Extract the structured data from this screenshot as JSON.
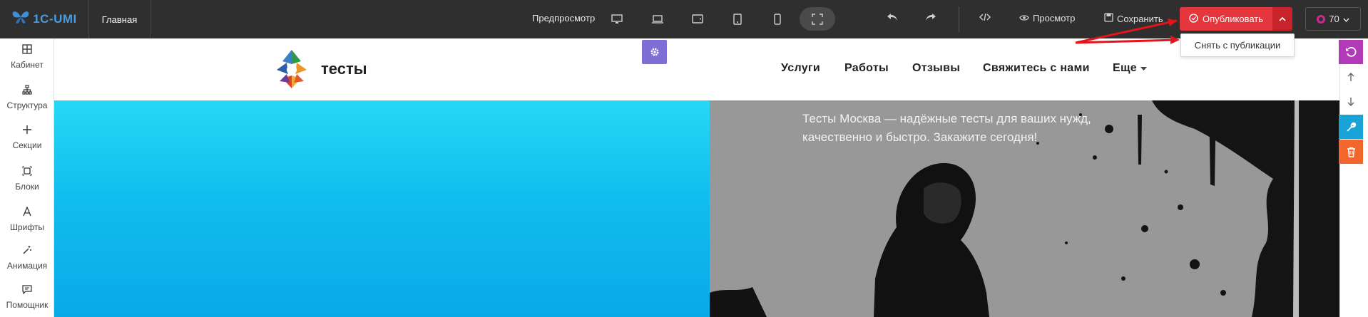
{
  "app": {
    "logo_text": "1C-UMI",
    "page_tab": "Главная"
  },
  "toolbar": {
    "preview_label": "Предпросмотр",
    "devices": [
      "desktop-icon",
      "laptop-icon",
      "tablet-landscape-icon",
      "tablet-icon",
      "mobile-icon",
      "fullscreen-icon"
    ],
    "view_label": "Просмотр",
    "save_label": "Сохранить",
    "publish_label": "Опубликовать",
    "zoom_value": "70",
    "publish_menu": {
      "unpublish_label": "Снять с публикации"
    },
    "colors": {
      "publish": "#e5363d",
      "publish_caret": "#c8222a",
      "bar": "#2f2f2f"
    }
  },
  "sidebar": {
    "items": [
      {
        "label": "Кабинет",
        "icon": "cabinet-icon"
      },
      {
        "label": "Структура",
        "icon": "structure-icon"
      },
      {
        "label": "Секции",
        "icon": "plus-icon"
      },
      {
        "label": "Блоки",
        "icon": "blocks-icon"
      },
      {
        "label": "Шрифты",
        "icon": "fonts-icon"
      },
      {
        "label": "Анимация",
        "icon": "magic-wand-icon"
      },
      {
        "label": "Помощник",
        "icon": "chat-icon"
      }
    ]
  },
  "site": {
    "name": "тесты",
    "nav": [
      "Услуги",
      "Работы",
      "Отзывы",
      "Свяжитесь с нами",
      "Еще"
    ],
    "hero_text": "Тесты Москва — надёжные тесты для ваших нужд, качественно и быстро. Закажите сегодня!",
    "colors": {
      "hero_left": "#11bdee",
      "hero_right": "#989898",
      "gear": "#7e6fd4"
    }
  },
  "right_tools": {
    "buttons": [
      "undo-icon",
      "arrow-up-icon",
      "arrow-down-icon",
      "wrench-icon",
      "trash-icon"
    ],
    "colors": {
      "undo": "#b23ab8",
      "wrench": "#1aa3d6",
      "trash": "#f2662e"
    }
  }
}
